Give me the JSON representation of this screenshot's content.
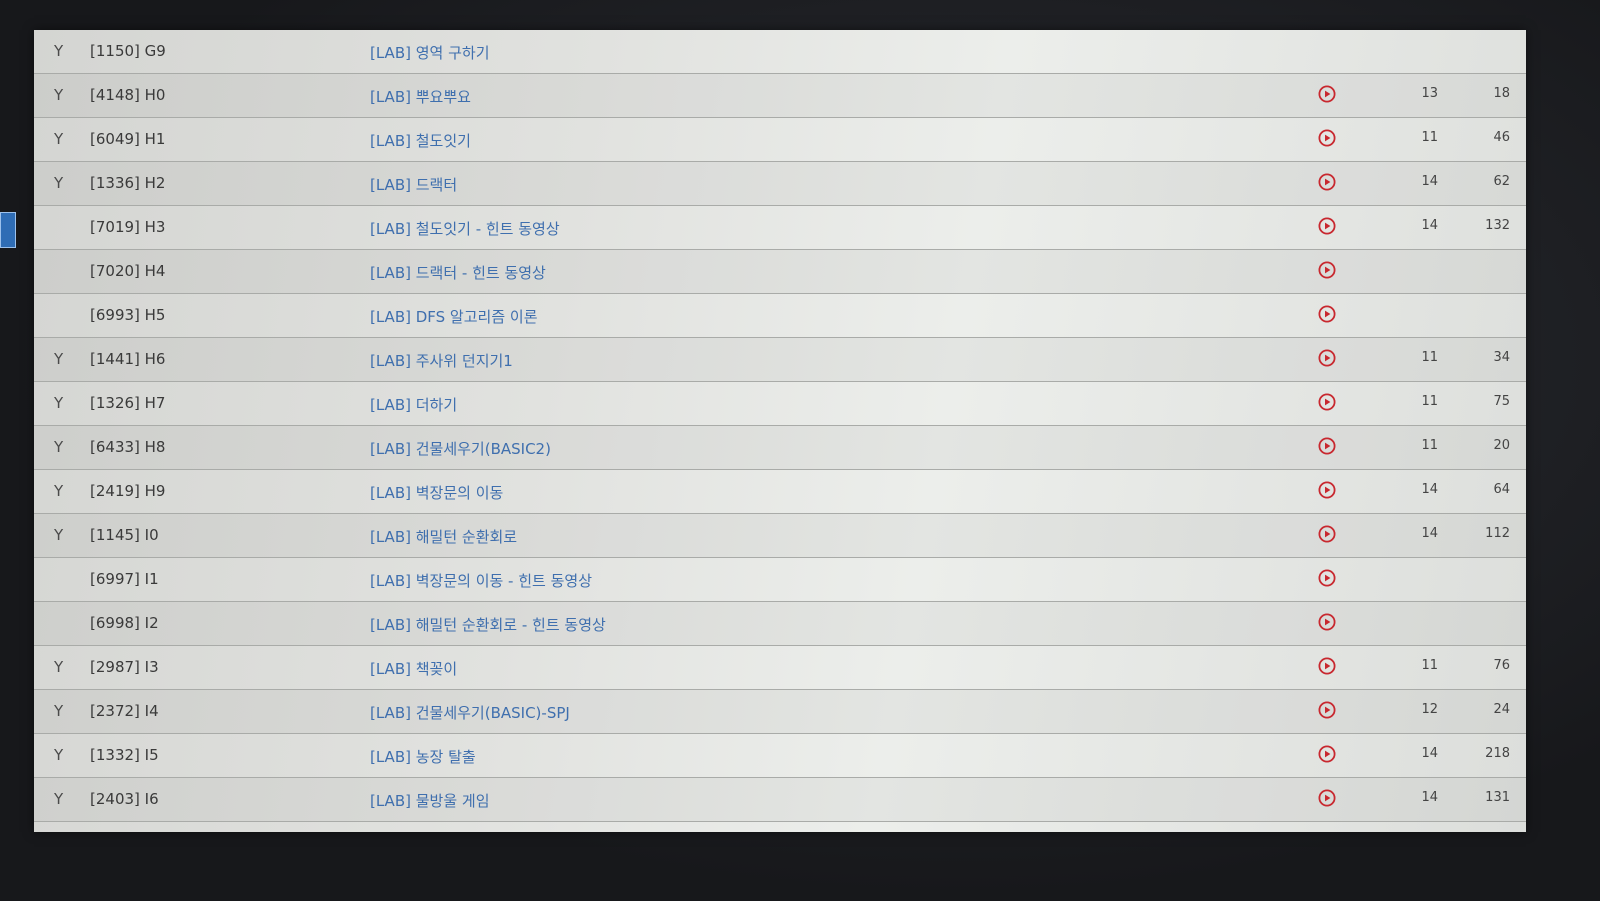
{
  "colors": {
    "play_icon": "#c8282f",
    "title_link": "#3f6fae",
    "highlight": "#2f6db5"
  },
  "rows": [
    {
      "solved": "Y",
      "code": "[1150] G9",
      "title": "[LAB] 영역 구하기",
      "count": "",
      "score": ""
    },
    {
      "solved": "Y",
      "code": "[4148] H0",
      "title": "[LAB] 뿌요뿌요",
      "count": "13",
      "score": "18"
    },
    {
      "solved": "Y",
      "code": "[6049] H1",
      "title": "[LAB] 철도잇기",
      "count": "11",
      "score": "46"
    },
    {
      "solved": "Y",
      "code": "[1336] H2",
      "title": "[LAB] 드랙터",
      "count": "14",
      "score": "62"
    },
    {
      "solved": "",
      "code": "[7019] H3",
      "title": "[LAB] 철도잇기 - 힌트 동영상",
      "count": "14",
      "score": "132"
    },
    {
      "solved": "",
      "code": "[7020] H4",
      "title": "[LAB] 드랙터 - 힌트 동영상",
      "count": "",
      "score": ""
    },
    {
      "solved": "",
      "code": "[6993] H5",
      "title": "[LAB] DFS 알고리즘 이론",
      "count": "",
      "score": ""
    },
    {
      "solved": "Y",
      "code": "[1441] H6",
      "title": "[LAB] 주사위 던지기1",
      "count": "11",
      "score": "34"
    },
    {
      "solved": "Y",
      "code": "[1326] H7",
      "title": "[LAB] 더하기",
      "count": "11",
      "score": "75"
    },
    {
      "solved": "Y",
      "code": "[6433] H8",
      "title": "[LAB] 건물세우기(BASIC2)",
      "count": "11",
      "score": "20"
    },
    {
      "solved": "Y",
      "code": "[2419] H9",
      "title": "[LAB] 벽장문의 이동",
      "count": "14",
      "score": "64"
    },
    {
      "solved": "Y",
      "code": "[1145] I0",
      "title": "[LAB] 해밀턴 순환회로",
      "count": "14",
      "score": "112"
    },
    {
      "solved": "",
      "code": "[6997] I1",
      "title": "[LAB] 벽장문의 이동 - 힌트 동영상",
      "count": "",
      "score": ""
    },
    {
      "solved": "",
      "code": "[6998] I2",
      "title": "[LAB] 해밀턴 순환회로 - 힌트 동영상",
      "count": "",
      "score": ""
    },
    {
      "solved": "Y",
      "code": "[2987] I3",
      "title": "[LAB] 책꽂이",
      "count": "11",
      "score": "76"
    },
    {
      "solved": "Y",
      "code": "[2372] I4",
      "title": "[LAB] 건물세우기(BASIC)-SPJ",
      "count": "12",
      "score": "24"
    },
    {
      "solved": "Y",
      "code": "[1332] I5",
      "title": "[LAB] 농장 탈출",
      "count": "14",
      "score": "218"
    },
    {
      "solved": "Y",
      "code": "[2403] I6",
      "title": "[LAB] 물방울 게임",
      "count": "14",
      "score": "131"
    }
  ]
}
